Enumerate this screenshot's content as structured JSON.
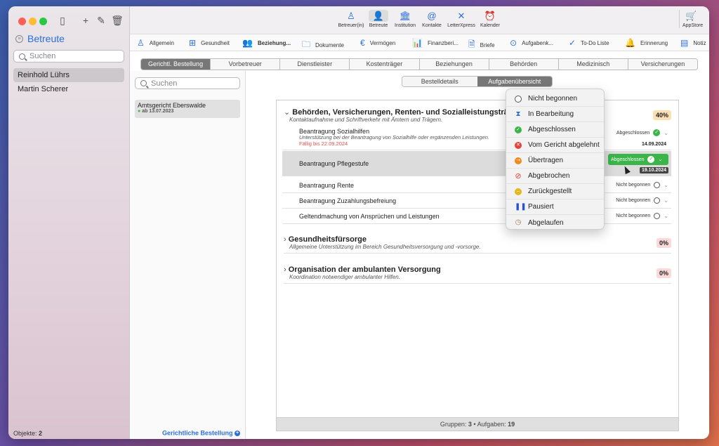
{
  "sidebar": {
    "title": "Betreute",
    "search_placeholder": "Suchen",
    "people": [
      "Reinhold Lührs",
      "Martin Scherer"
    ],
    "footer_label": "Objekte:",
    "footer_count": "2"
  },
  "toolbar": {
    "items": [
      {
        "label": "Betreuer(in)",
        "icon": "person-outline-icon"
      },
      {
        "label": "Betreute",
        "icon": "person-icon"
      },
      {
        "label": "Institution",
        "icon": "building-icon"
      },
      {
        "label": "Kontakte",
        "icon": "contacts-icon"
      },
      {
        "label": "LetterXpress",
        "icon": "letterxpress-icon"
      },
      {
        "label": "Kalender",
        "icon": "alarm-clock-icon"
      }
    ],
    "appstore": "AppStore"
  },
  "tabs1": [
    {
      "label": "Allgemein",
      "icon": "person-icon"
    },
    {
      "label": "Gesundheit",
      "icon": "medical-icon"
    },
    {
      "label": "Beziehung...",
      "icon": "people-icon"
    },
    {
      "label": "Dokumente",
      "icon": "folder-icon"
    },
    {
      "label": "Vermögen",
      "icon": "euro-icon"
    },
    {
      "label": "Finanzberi...",
      "icon": "chart-icon"
    },
    {
      "label": "Briefe",
      "icon": "document-icon"
    },
    {
      "label": "Aufgabenk...",
      "icon": "task-icon"
    },
    {
      "label": "To-Do Liste",
      "icon": "check-circle-icon"
    },
    {
      "label": "Erinnerung",
      "icon": "bell-icon"
    },
    {
      "label": "Notiz",
      "icon": "note-icon"
    }
  ],
  "tabs2": [
    "Gerichtl. Bestellung",
    "Vorbetreuer",
    "Dienstleister",
    "Kostenträger",
    "Beziehungen",
    "Behörden",
    "Medizinisch",
    "Versicherungen"
  ],
  "col2": {
    "search_placeholder": "Suchen",
    "card_name": "Amtsgericht Eberswalde",
    "card_date": "ab 13.07.2023",
    "footer": "Gerichtliche Bestellung",
    "footer_icon": "+"
  },
  "segment": [
    "Bestelldetails",
    "Aufgabenübersicht"
  ],
  "groups": [
    {
      "title": "Behörden, Versicherungen, Renten- und Sozialleistungsträgern",
      "subtitle": "Kontaktaufnahme und Schriftverkehr mit Ämtern und Trägern.",
      "percent": "40%"
    },
    {
      "title": "Gesundheitsfürsorge",
      "subtitle": "Allgemeine Unterstützung im Bereich Gesundheitsversorgung und -vorsorge.",
      "percent": "0%"
    },
    {
      "title": "Organisation der ambulanten Versorgung",
      "subtitle": "Koordination notwendiger ambulanter Hilfen.",
      "percent": "0%"
    }
  ],
  "tasks": [
    {
      "name": "Beantragung Sozialhilfen",
      "subtitle": "Unterstützung bei der Beantragung von Sozialhilfe oder ergänzenden Leistungen.",
      "due": "Fällig bis 22.09.2024",
      "status": "Abgeschlossen",
      "date": "14.09.2024"
    },
    {
      "name": "Beantragung Pflegestufe",
      "status": "Abgeschlossen",
      "date": "19.10.2024"
    },
    {
      "name": "Beantragung Rente",
      "status": "Nicht begonnen"
    },
    {
      "name": "Beantragung Zuzahlungsbefreiung",
      "status": "Nicht begonnen"
    },
    {
      "name": "Geltendmachung von Ansprüchen und Leistungen",
      "status": "Nicht begonnen"
    }
  ],
  "panel_footer": {
    "groups_label": "Gruppen:",
    "groups_value": "3",
    "sep": "•",
    "tasks_label": "Aufgaben:",
    "tasks_value": "19"
  },
  "status_menu": [
    {
      "label": "Nicht begonnen",
      "icon": "empty-circle-icon",
      "color": "#ffffff"
    },
    {
      "label": "In Bearbeitung",
      "icon": "hourglass-icon",
      "color": "#2a6fdc"
    },
    {
      "label": "Abgeschlossen",
      "icon": "check-badge-icon",
      "color": "#3bb54a"
    },
    {
      "label": "Vom Gericht abgelehnt",
      "icon": "x-badge-icon",
      "color": "#e0443a"
    },
    {
      "label": "Übertragen",
      "icon": "transfer-icon",
      "color": "#f08a1c"
    },
    {
      "label": "Abgebrochen",
      "icon": "prohibited-icon",
      "color": "#e0443a"
    },
    {
      "label": "Zurückgestellt",
      "icon": "deferred-icon",
      "color": "#e5b81b"
    },
    {
      "label": "Pausiert",
      "icon": "pause-icon",
      "color": "#2a4fd0"
    },
    {
      "label": "Abgelaufen",
      "icon": "expired-clock-icon",
      "color": "#a07b50"
    }
  ]
}
